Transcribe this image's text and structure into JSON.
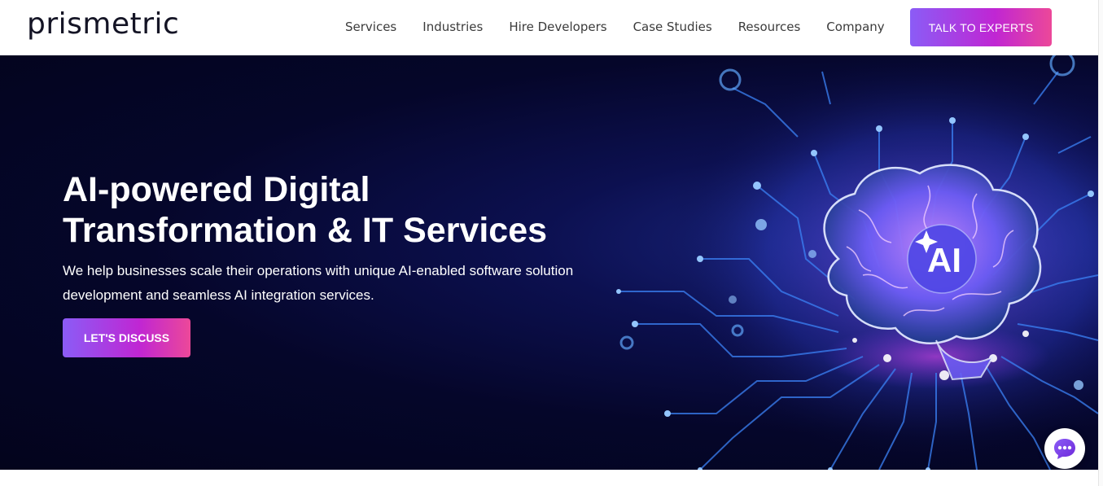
{
  "header": {
    "logo": "prismetric",
    "nav": [
      "Services",
      "Industries",
      "Hire Developers",
      "Case Studies",
      "Resources",
      "Company"
    ],
    "cta": "TALK TO EXPERTS"
  },
  "hero": {
    "title_line1": "AI-powered Digital",
    "title_line2": "Transformation & IT Services",
    "subtitle_line1": "We help businesses scale their operations with unique AI-enabled software solution",
    "subtitle_line2": "development and seamless AI integration services.",
    "cta": "LET'S DISCUSS",
    "badge": "AI"
  },
  "icons": {
    "chat": "chat-bubble-icon",
    "brain": "brain-icon",
    "sparkle": "sparkle-icon"
  },
  "colors": {
    "accent_start": "#8b5cf6",
    "accent_end": "#ec4899",
    "hero_bg": "#05062a",
    "circuit": "#3b82f6"
  }
}
